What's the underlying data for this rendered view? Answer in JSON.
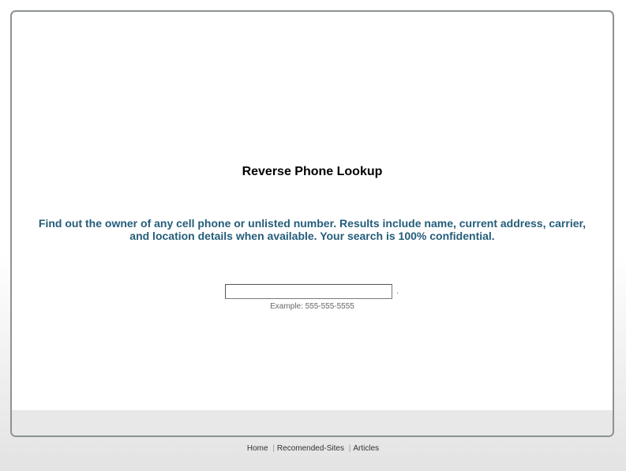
{
  "page": {
    "title": "Reverse Phone Lookup",
    "description": "Find out the owner of any cell phone or unlisted number. Results include name, current address, carrier, and location details when available. Your search is 100% confidential."
  },
  "search": {
    "value": "",
    "placeholder": "",
    "submit_label": ".",
    "example": "Example: 555-555-5555"
  },
  "footer": {
    "links": [
      {
        "label": "Home"
      },
      {
        "label": "Recomended-Sites"
      },
      {
        "label": "Articles"
      }
    ],
    "separator": "|"
  },
  "colors": {
    "panel_border": "#8c9294",
    "description_text": "#245d7a",
    "footer_band": "#e8e8e8"
  }
}
